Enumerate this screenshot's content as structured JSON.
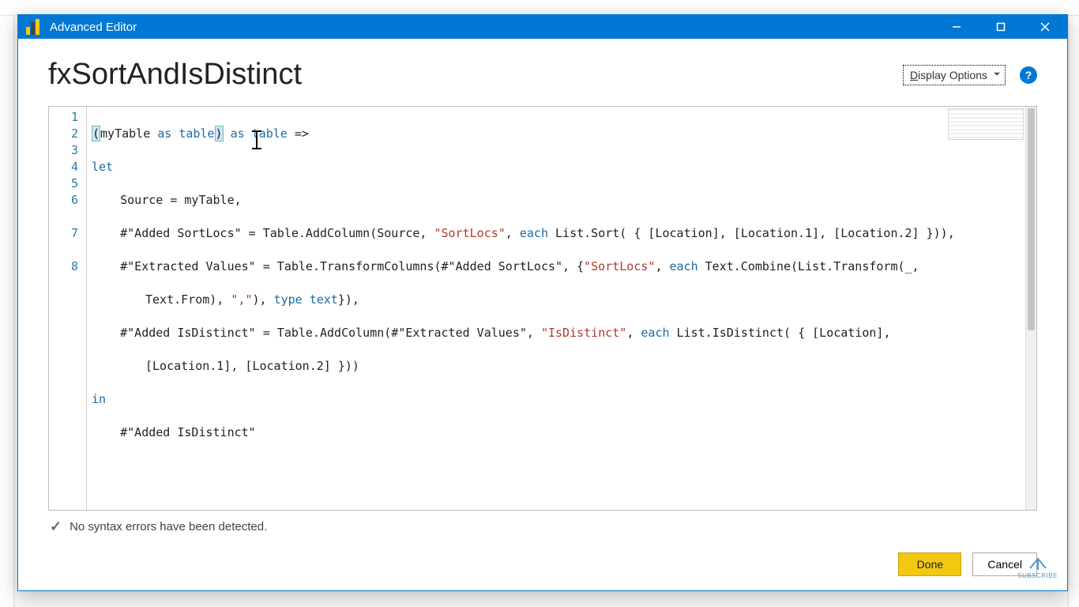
{
  "window": {
    "title": "Advanced Editor"
  },
  "header": {
    "query_name": "fxSortAndIsDistinct",
    "display_options_label": "Display Options",
    "help_glyph": "?"
  },
  "editor": {
    "line_numbers": [
      "1",
      "2",
      "3",
      "4",
      "5",
      "6",
      "7",
      "8"
    ],
    "code": {
      "l1": {
        "a": "(myTable ",
        "kw_as1": "as",
        "b": " ",
        "kw_table1": "table",
        "c": ") ",
        "kw_as2": "as",
        "d": " ",
        "kw_table2": "table",
        "e": " =>"
      },
      "l2": {
        "kw_let": "let"
      },
      "l3": {
        "a": "    Source = myTable,"
      },
      "l4": {
        "a": "    #\"Added SortLocs\" = Table.AddColumn(Source, ",
        "s": "\"SortLocs\"",
        "b": ", ",
        "kw_each": "each",
        "c": " List.Sort( { [Location], [Location.1], [Location.2] })),"
      },
      "l5": {
        "a": "    #\"Extracted Values\" = Table.TransformColumns(#\"Added SortLocs\", {",
        "s": "\"SortLocs\"",
        "b": ", ",
        "kw_each": "each",
        "c": " Text.Combine(List.Transform(_, "
      },
      "l5b": {
        "a": "Text.From), ",
        "s": "\",\"",
        "b": "), ",
        "kw_type": "type",
        "c": " ",
        "kw_text": "text",
        "d": "}),"
      },
      "l6": {
        "a": "    #\"Added IsDistinct\" = Table.AddColumn(#\"Extracted Values\", ",
        "s": "\"IsDistinct\"",
        "b": ", ",
        "kw_each": "each",
        "c": " List.IsDistinct( { [Location], "
      },
      "l6b": {
        "a": "[Location.1], [Location.2] }))"
      },
      "l7": {
        "kw_in": "in"
      },
      "l8": {
        "a": "    #\"Added IsDistinct\""
      }
    }
  },
  "status": {
    "message": "No syntax errors have been detected."
  },
  "buttons": {
    "done": "Done",
    "cancel": "Cancel"
  },
  "overlay": {
    "subscribe": "SUBSCRIBE"
  }
}
